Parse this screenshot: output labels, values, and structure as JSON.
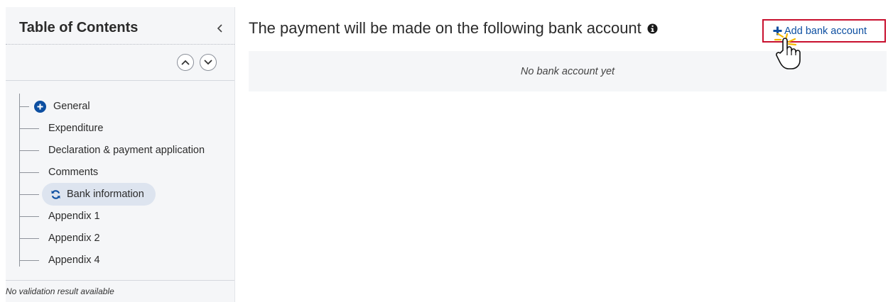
{
  "sidebar": {
    "title": "Table of Contents",
    "collapse_icon": "chevron-left-icon",
    "nav_up_icon": "chevron-up-icon",
    "nav_down_icon": "chevron-down-icon",
    "items": [
      {
        "label": "General",
        "icon": "plus-circle-icon",
        "expandable": true
      },
      {
        "label": "Expenditure"
      },
      {
        "label": "Declaration & payment application"
      },
      {
        "label": "Comments"
      },
      {
        "label": "Bank information",
        "icon": "refresh-icon",
        "active": true
      },
      {
        "label": "Appendix 1"
      },
      {
        "label": "Appendix 2"
      },
      {
        "label": "Appendix 4"
      }
    ],
    "footer": "No validation result available"
  },
  "main": {
    "title": "The payment will be made on the following bank account",
    "info_icon": "info-icon",
    "add_button": {
      "label": "Add bank account",
      "icon": "plus-icon"
    },
    "empty_message": "No bank account yet"
  },
  "colors": {
    "accent": "#0d4fa1",
    "highlight_border": "#c8102e",
    "active_item_bg": "#dde4ef",
    "panel_bg": "#f5f6f8"
  }
}
